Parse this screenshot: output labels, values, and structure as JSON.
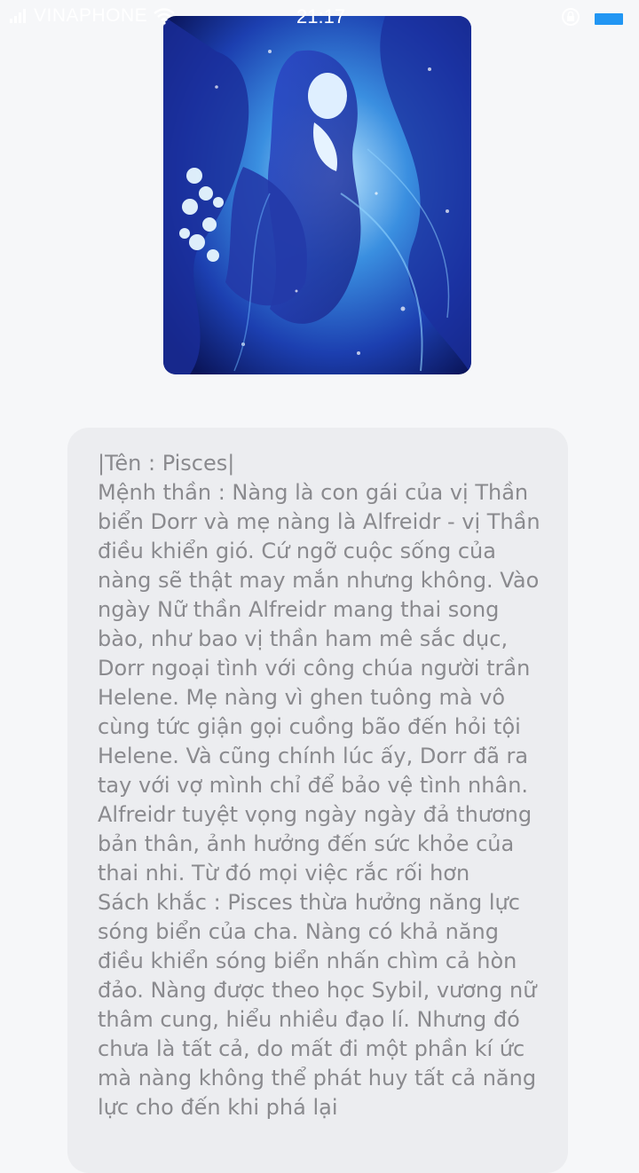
{
  "status_bar": {
    "carrier": "VINAPHONE",
    "time": "21:17"
  },
  "hero_image": {
    "description_icon": "anime-girl-image"
  },
  "message": {
    "paragraphs": [
      "|Tên : Pisces|",
      "Mệnh thần : Nàng là con gái của vị Thần biển Dorr và mẹ nàng là Alfreidr - vị Thần điều khiển gió. Cứ ngỡ cuộc sống của nàng sẽ thật may mắn nhưng không. Vào ngày Nữ thần Alfreidr mang thai song bào, như bao vị thần ham mê sắc dục, Dorr ngoại tình với công chúa người trần Helene. Mẹ nàng vì ghen tuông mà vô cùng tức giận gọi cuồng bão đến hỏi tội Helene. Và cũng chính lúc ấy, Dorr đã ra tay với vợ mình chỉ để bảo vệ tình nhân. Alfreidr tuyệt vọng ngày ngày đả thương bản thân, ảnh hưởng đến sức khỏe của thai nhi. Từ đó mọi việc rắc rối hơn",
      "Sách khắc : Pisces thừa hưởng năng lực sóng biển của cha. Nàng có khả năng điều khiển sóng biển nhấn chìm cả hòn đảo. Nàng được theo học Sybil, vương nữ thâm cung, hiểu nhiều đạo lí. Nhưng đó chưa là tất cả, do mất đi một phần kí ức mà nàng không thể phát huy tất cả năng lực cho đến khi phá lại"
    ]
  }
}
